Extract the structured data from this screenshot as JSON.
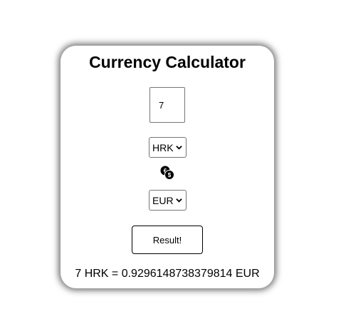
{
  "calculator": {
    "title": "Currency Calculator",
    "amount_value": "7",
    "from_currency": "HRK",
    "to_currency": "EUR",
    "swap_icon": "currency-exchange-icon",
    "button_label": "Result!",
    "result_text": "7 HRK = 0.9296148738379814 EUR"
  }
}
